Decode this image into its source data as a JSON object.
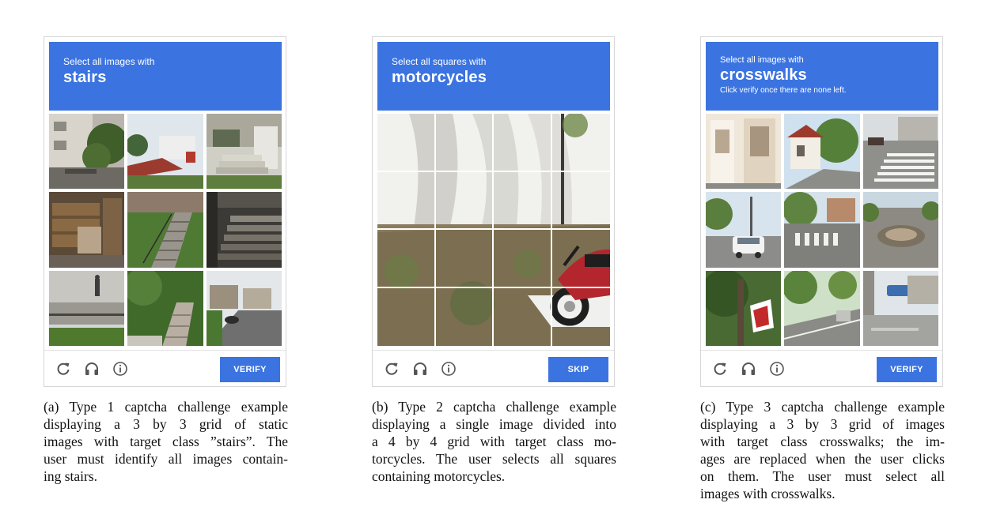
{
  "panels": [
    {
      "id": "a",
      "header": {
        "line1": "Select all images with",
        "line2": "stairs",
        "line3": ""
      },
      "action_label": "VERIFY",
      "caption_lines": [
        "(a) Type 1 captcha challenge example",
        "displaying a 3 by 3 grid of static",
        "images with target class ”stairs”. The",
        "user must identify all images contain-",
        "ing stairs."
      ]
    },
    {
      "id": "b",
      "header": {
        "line1": "Select all squares with",
        "line2": "motorcycles",
        "line3": ""
      },
      "action_label": "SKIP",
      "caption_lines": [
        "(b) Type 2 captcha challenge example",
        "displaying a single image divided into",
        "a 4 by 4 grid with target class mo-",
        "torcycles. The user selects all squares",
        "containing motorcycles."
      ]
    },
    {
      "id": "c",
      "header": {
        "line1": "Select all images with",
        "line2": "crosswalks",
        "line3": "Click verify once there are none left."
      },
      "action_label": "VERIFY",
      "caption_lines": [
        "(c) Type 3 captcha challenge example",
        "displaying a 3 by 3 grid of images",
        "with target class crosswalks; the im-",
        "ages are replaced when the user clicks",
        "on them. The user must select all",
        "images with crosswalks."
      ]
    }
  ],
  "icons": [
    "reload-icon",
    "audio-challenge-icon",
    "info-icon"
  ],
  "colors": {
    "accent": "#3b74e0",
    "icon": "#555555",
    "caption_text": "#111111"
  }
}
